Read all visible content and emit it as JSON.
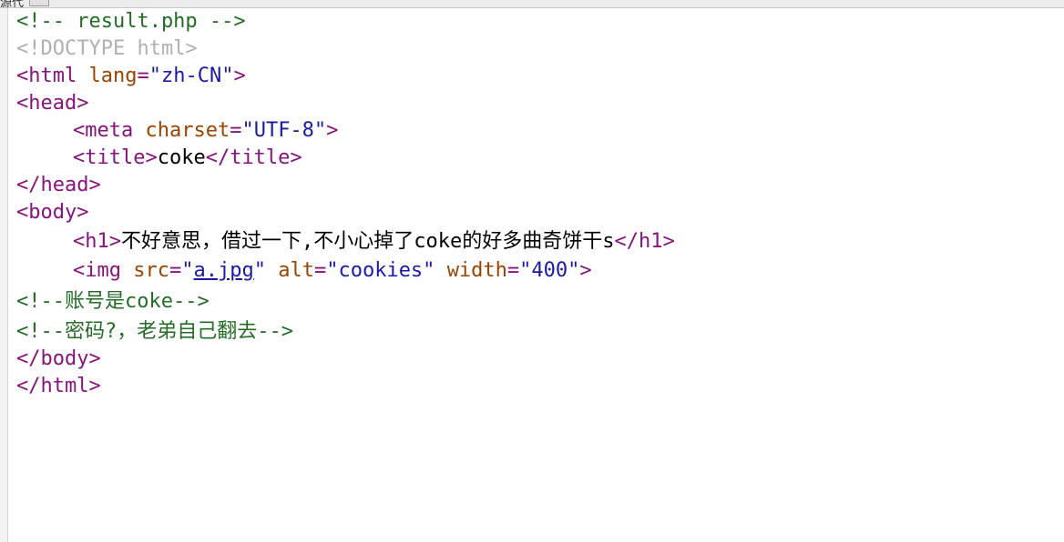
{
  "window": {
    "title_fragment": "源代"
  },
  "source_lines": [
    {
      "kind": "comment",
      "text": "<!-- result.php -->"
    },
    {
      "kind": "doctype",
      "text": "<!DOCTYPE html>"
    },
    {
      "html_open": "<html",
      "html_lang_attr": "lang",
      "html_lang_value": "\"zh-CN\"",
      "html_close": ">"
    },
    {
      "text": "<head>"
    },
    {
      "meta_open": "<meta",
      "meta_attr": "charset",
      "meta_value": "\"UTF-8\"",
      "meta_close": ">"
    },
    {
      "title_open": "<title>",
      "title_text": "coke",
      "title_close": "</title>"
    },
    {
      "text": "</head>"
    },
    {
      "text": "<body>"
    },
    {
      "h1_open": "<h1>",
      "h1_text": "不好意思，借过一下,不小心掉了coke的好多曲奇饼干s",
      "h1_close": "</h1>"
    },
    {
      "img_open": "<img",
      "src_attr": "src",
      "src_q1": "\"",
      "src_link": "a.jpg",
      "src_q2": "\"",
      "alt_attr": "alt",
      "alt_value": "\"cookies\"",
      "width_attr": "width",
      "width_value": "\"400\"",
      "img_close": ">"
    },
    {
      "kind": "comment",
      "text": "<!--账号是coke-->"
    },
    {
      "kind": "comment",
      "text": "<!--密码?，老弟自己翻去-->"
    },
    {
      "text": "</body>"
    },
    {
      "text": "</html>"
    }
  ]
}
